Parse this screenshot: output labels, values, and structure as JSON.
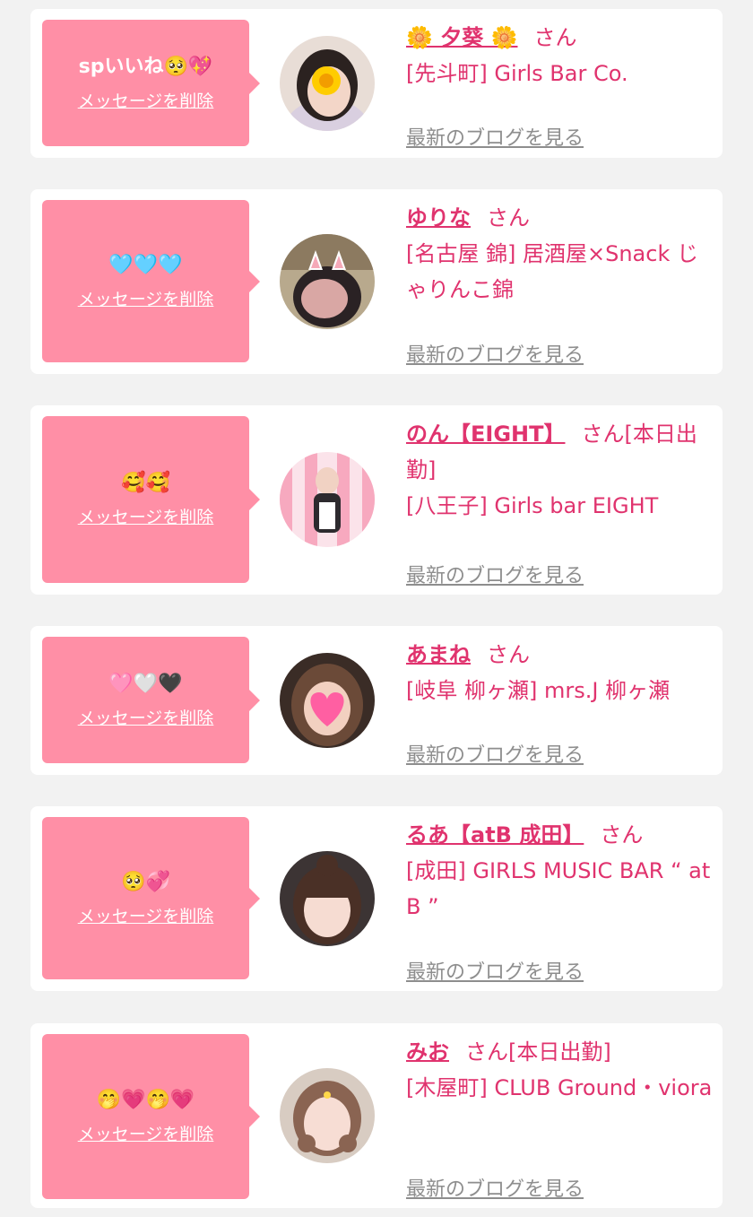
{
  "delete_label": "メッセージを削除",
  "blog_label": "最新のブログを見る",
  "colors": {
    "accent": "#e0336e",
    "bubble": "#ff8fa6",
    "link_gray": "#8e8e8e",
    "background": "#f2f2f2"
  },
  "entries": [
    {
      "message": "spいいね🥺💖",
      "name": "🌼 夕葵 🌼",
      "suffix": "さん",
      "shop": "[先斗町] Girls Bar Co."
    },
    {
      "message": "🩵🩵🩵",
      "name": "ゆりな",
      "suffix": "さん",
      "shop": "[名古屋 錦] 居酒屋×Snack じゃりんこ錦"
    },
    {
      "message": "🥰🥰",
      "name": "のん【EIGHT】",
      "suffix": "さん[本日出勤]",
      "shop": "[八王子] Girls bar EIGHT"
    },
    {
      "message": "🩷🤍🖤",
      "name": "あまね",
      "suffix": "さん",
      "shop": "[岐阜 柳ヶ瀬] mrs.J 柳ヶ瀬"
    },
    {
      "message": "🥺💞",
      "name": "るあ【atB 成田】",
      "suffix": "さん",
      "shop": "[成田] GIRLS MUSIC BAR “ at B ”"
    },
    {
      "message": "🤭💗🤭💗",
      "name": "みお",
      "suffix": "さん[本日出勤]",
      "shop": "[木屋町] CLUB Ground・viora"
    }
  ]
}
